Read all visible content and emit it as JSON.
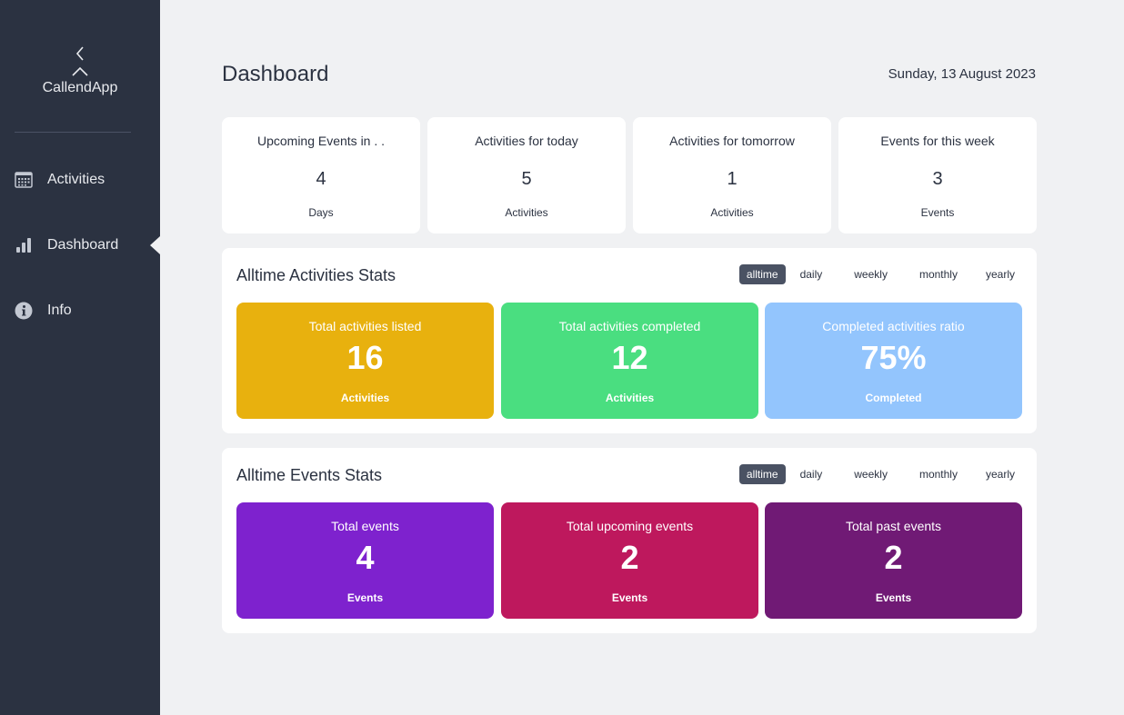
{
  "sidebar": {
    "app_name": "CallendApp",
    "items": [
      {
        "label": "Activities",
        "icon": "calendar-icon"
      },
      {
        "label": "Dashboard",
        "icon": "bar-chart-icon",
        "active": true
      },
      {
        "label": "Info",
        "icon": "info-icon"
      }
    ]
  },
  "header": {
    "title": "Dashboard",
    "date": "Sunday, 13 August 2023"
  },
  "summary": [
    {
      "title": "Upcoming Events in . .",
      "value": "4",
      "unit": "Days"
    },
    {
      "title": "Activities for today",
      "value": "5",
      "unit": "Activities"
    },
    {
      "title": "Activities for tomorrow",
      "value": "1",
      "unit": "Activities"
    },
    {
      "title": "Events for this week",
      "value": "3",
      "unit": "Events"
    }
  ],
  "filters": [
    "alltime",
    "daily",
    "weekly",
    "monthly",
    "yearly"
  ],
  "activities_panel": {
    "title": "Alltime Activities Stats",
    "active_filter": "alltime",
    "cards": [
      {
        "title": "Total activities listed",
        "value": "16",
        "unit": "Activities",
        "color": "#e8b10e"
      },
      {
        "title": "Total activities completed",
        "value": "12",
        "unit": "Activities",
        "color": "#4ade80"
      },
      {
        "title": "Completed activities ratio",
        "value": "75%",
        "unit": "Completed",
        "color": "#93c5fd"
      }
    ]
  },
  "events_panel": {
    "title": "Alltime Events Stats",
    "active_filter": "alltime",
    "cards": [
      {
        "title": "Total events",
        "value": "4",
        "unit": "Events",
        "color": "#7e22ce"
      },
      {
        "title": "Total upcoming events",
        "value": "2",
        "unit": "Events",
        "color": "#be185d"
      },
      {
        "title": "Total past events",
        "value": "2",
        "unit": "Events",
        "color": "#701a75"
      }
    ]
  }
}
